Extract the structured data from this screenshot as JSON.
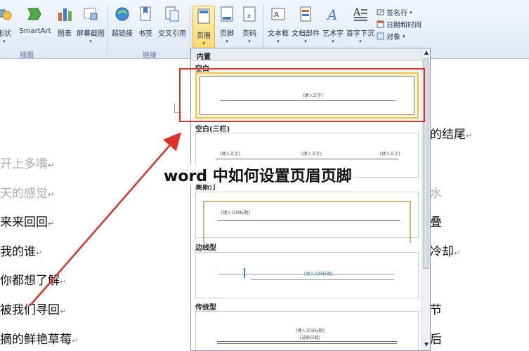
{
  "ribbon": {
    "buttons": [
      {
        "label": "形状",
        "icon": "shapes-icon"
      },
      {
        "label": "SmartArt",
        "icon": "smartart-icon"
      },
      {
        "label": "图表",
        "icon": "chart-icon"
      },
      {
        "label": "屏幕截图",
        "icon": "screenshot-icon"
      },
      {
        "label": "超链接",
        "icon": "hyperlink-icon"
      },
      {
        "label": "书签",
        "icon": "bookmark-icon"
      },
      {
        "label": "交叉引用",
        "icon": "cross-reference-icon"
      },
      {
        "label": "页眉",
        "icon": "header-icon"
      },
      {
        "label": "页脚",
        "icon": "footer-icon"
      },
      {
        "label": "页码",
        "icon": "page-number-icon"
      },
      {
        "label": "文本框",
        "icon": "textbox-icon"
      },
      {
        "label": "文档部件",
        "icon": "quick-parts-icon"
      },
      {
        "label": "艺术字",
        "icon": "wordart-icon"
      },
      {
        "label": "首字下沉",
        "icon": "drop-cap-icon"
      }
    ],
    "small_buttons": [
      {
        "label": "签名行",
        "icon": "signature-icon"
      },
      {
        "label": "日期和时间",
        "icon": "date-time-icon"
      },
      {
        "label": "对象",
        "icon": "object-icon"
      }
    ],
    "groups": {
      "illustrations": "插图",
      "links": "链接"
    }
  },
  "gallery": {
    "header": "内置",
    "sections": {
      "blank": "空白",
      "blank_three": "空白(三栏)",
      "austin": "奥斯汀",
      "sideline": "边线型",
      "traditional": "传统型"
    },
    "placeholders": {
      "type_text": "[键入文字]",
      "doc_title": "[键入文档标题]",
      "doc_title_bracket": "[键入文档标题]",
      "select_date": "[选取日期]"
    }
  },
  "document": {
    "lines_left": [
      "开上多嘴",
      "天的感觉",
      "来来回回",
      "我的谁",
      "你都想了解",
      "被我们寻回",
      "摘的鲜艳草莓"
    ],
    "lines_right": [
      "的结尾",
      "水",
      "叠",
      "冷却",
      "节",
      "后"
    ],
    "para_mark": "↵"
  },
  "caption": "word 中如何设置页眉页脚",
  "colors": {
    "annotation": "#e0302a",
    "active_button": "#ffd86a"
  }
}
